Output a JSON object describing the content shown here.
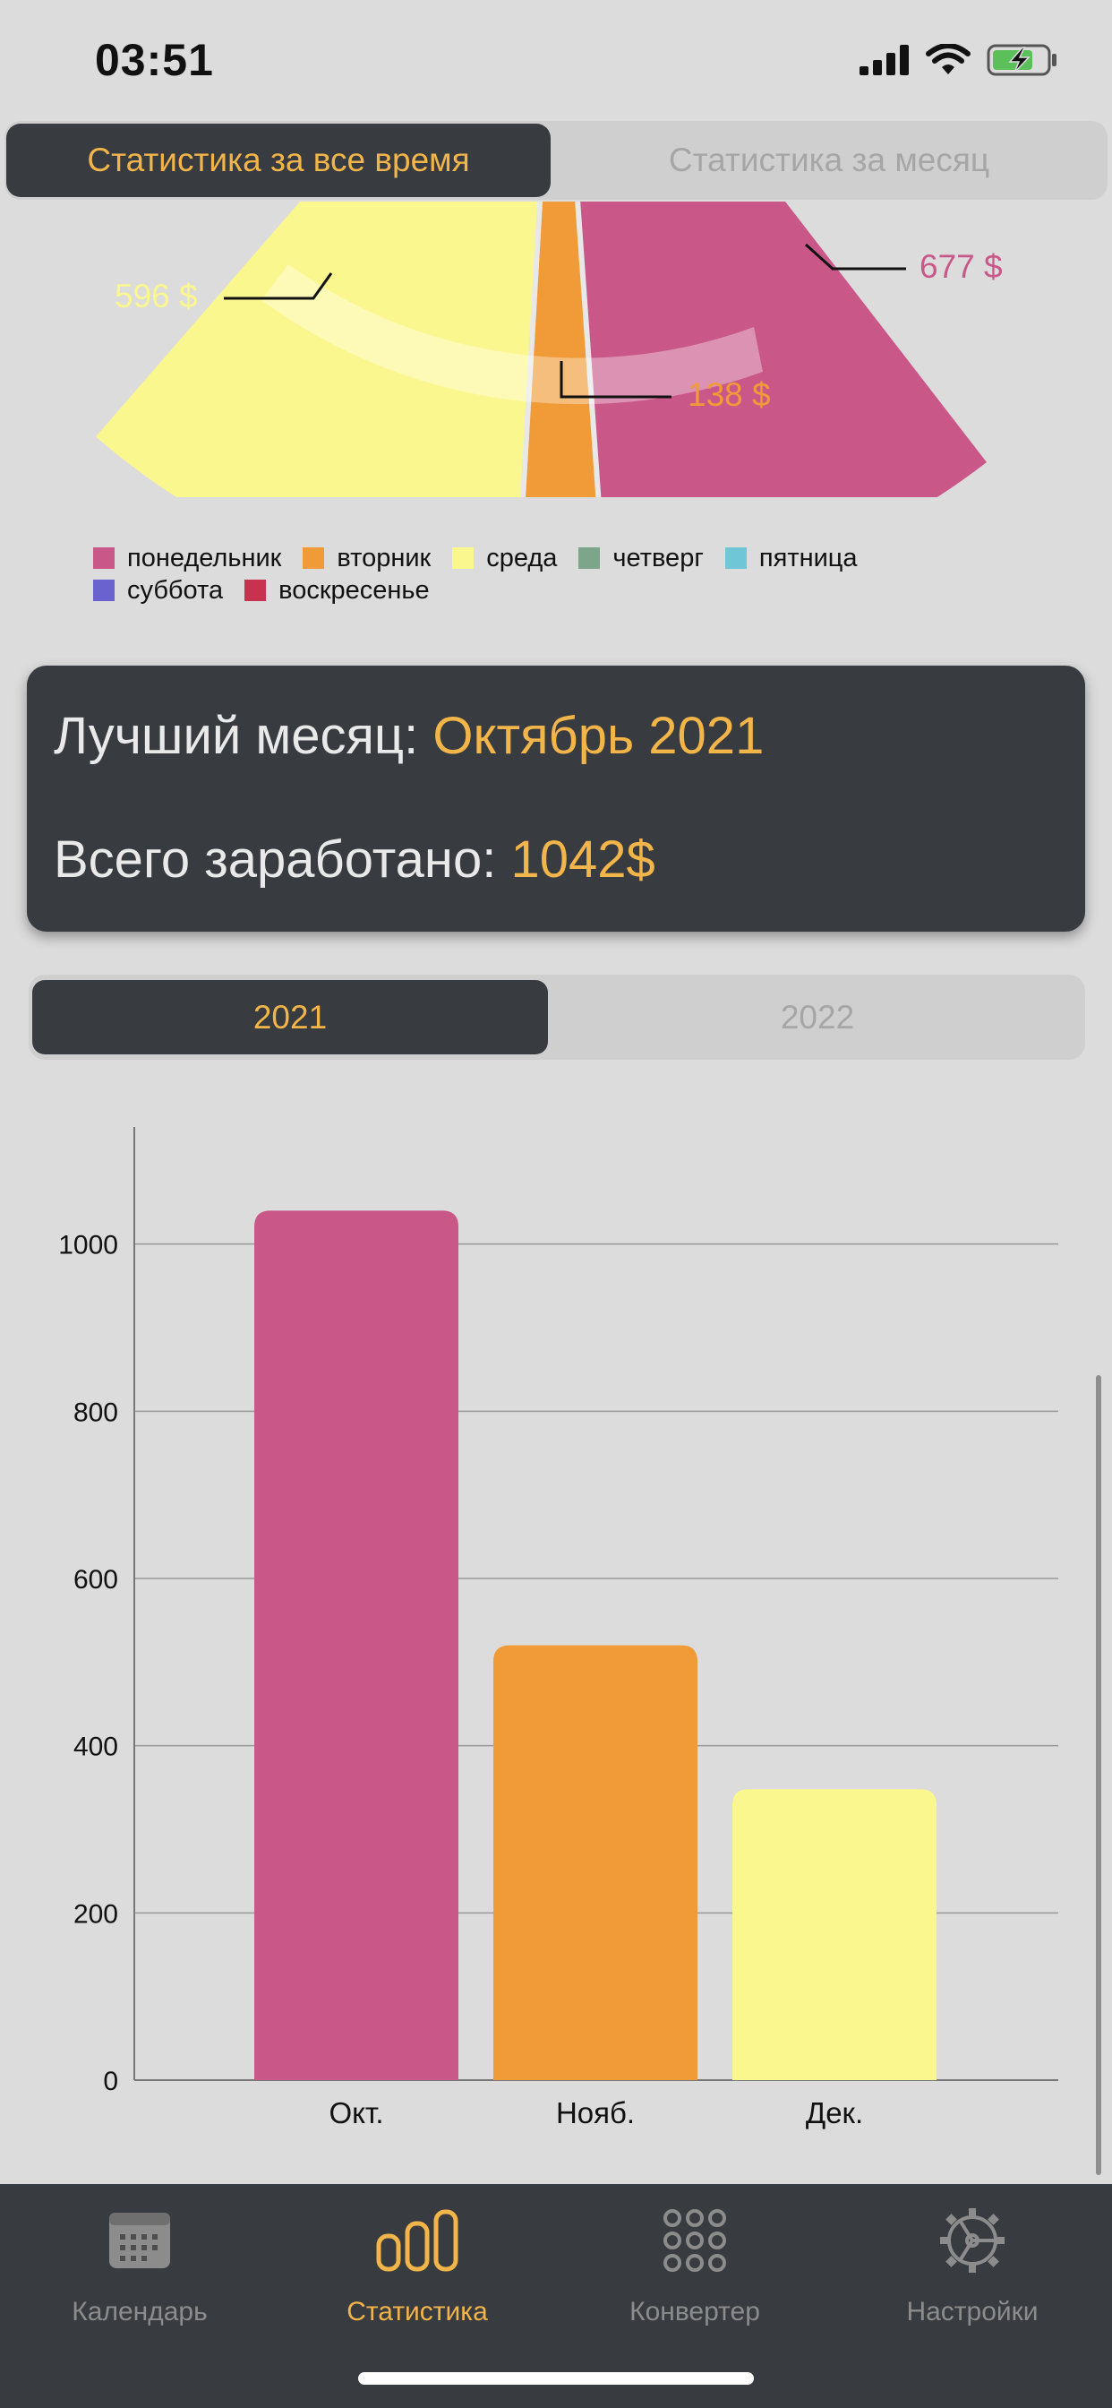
{
  "status_bar": {
    "time": "03:51"
  },
  "top_segment": {
    "all_time": "Статистика за все время",
    "month": "Статистика за месяц"
  },
  "pie": {
    "colors": {
      "monday": "#c95889",
      "tuesday": "#f09b38",
      "wednesday": "#fbf78f"
    },
    "labels": {
      "wednesday": "596 $",
      "tuesday": "138 $",
      "monday": "677 $"
    }
  },
  "legend": {
    "items": [
      {
        "label": "понедельник",
        "color": "#c95889"
      },
      {
        "label": "вторник",
        "color": "#f09b38"
      },
      {
        "label": "среда",
        "color": "#fbf78f"
      },
      {
        "label": "четверг",
        "color": "#7da58a"
      },
      {
        "label": "пятница",
        "color": "#6ec6d6"
      },
      {
        "label": "суббота",
        "color": "#6a63cf"
      },
      {
        "label": "воскресенье",
        "color": "#c8324f"
      }
    ]
  },
  "summary": {
    "best_month_label": "Лучший месяц:",
    "best_month_value": "Октябрь 2021",
    "total_label": "Всего заработано:",
    "total_value": "1042$"
  },
  "year_segment": {
    "selected": "2021",
    "other": "2022"
  },
  "chart_data": {
    "type": "bar",
    "categories": [
      "Окт.",
      "Нояб.",
      "Дек."
    ],
    "values": [
      1040,
      520,
      348
    ],
    "colors": [
      "#c95889",
      "#f09b38",
      "#fbf78f"
    ],
    "ylim": [
      0,
      1140
    ],
    "yticks": [
      0,
      200,
      400,
      600,
      800,
      1000
    ],
    "grid": true
  },
  "tabbar": {
    "items": [
      {
        "label": "Календарь",
        "icon": "calendar-icon"
      },
      {
        "label": "Статистика",
        "icon": "chart-bars-icon"
      },
      {
        "label": "Конвертер",
        "icon": "grid-dots-icon"
      },
      {
        "label": "Настройки",
        "icon": "gear-icon"
      }
    ],
    "active_color": "#f2b54a",
    "inactive_color": "#8c8c8c"
  }
}
